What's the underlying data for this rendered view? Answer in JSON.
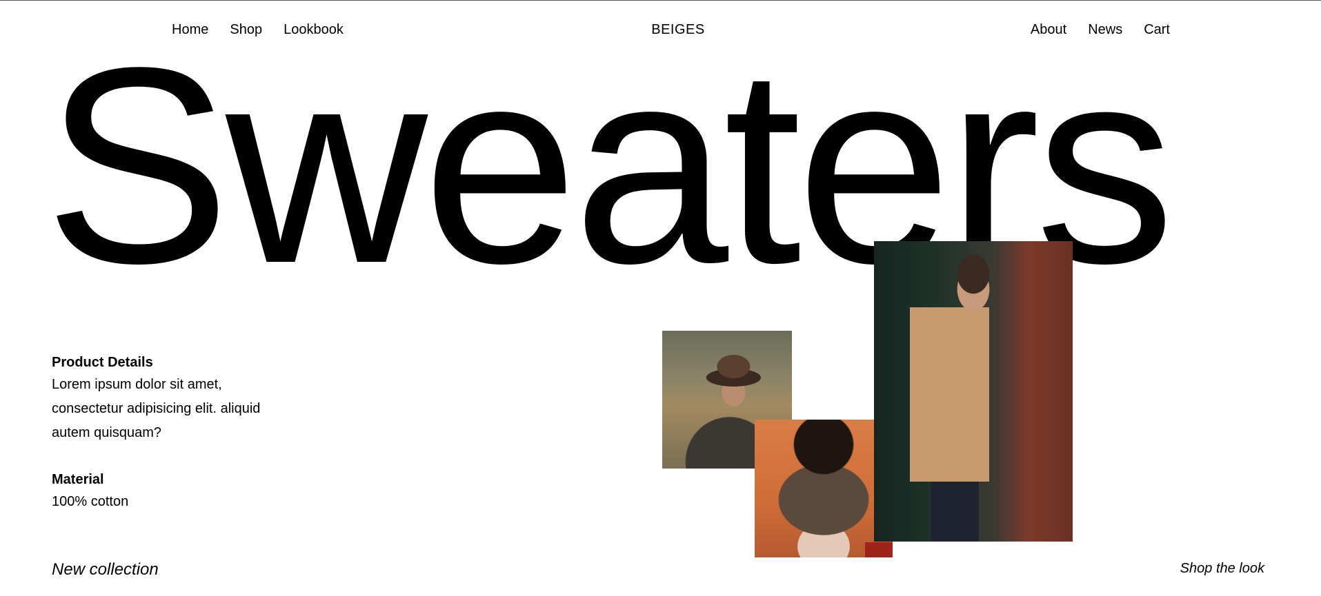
{
  "nav": {
    "left": [
      {
        "label": "Home"
      },
      {
        "label": "Shop"
      },
      {
        "label": "Lookbook"
      }
    ],
    "brand": "BEIGES",
    "right": [
      {
        "label": "About"
      },
      {
        "label": "News"
      },
      {
        "label": "Cart"
      }
    ]
  },
  "hero": {
    "title": "Sweaters"
  },
  "details": {
    "product_heading": "Product Details",
    "product_text": "Lorem ipsum dolor sit amet, consectetur adipisicing elit. aliquid autem quisquam?",
    "material_heading": "Material",
    "material_text": "100% cotton"
  },
  "footer": {
    "collection_label": "New collection",
    "shop_link": "Shop the look"
  },
  "photos": [
    {
      "name": "man-in-hat-photo"
    },
    {
      "name": "woman-in-cardigan-photo"
    },
    {
      "name": "man-in-camel-coat-photo"
    }
  ]
}
